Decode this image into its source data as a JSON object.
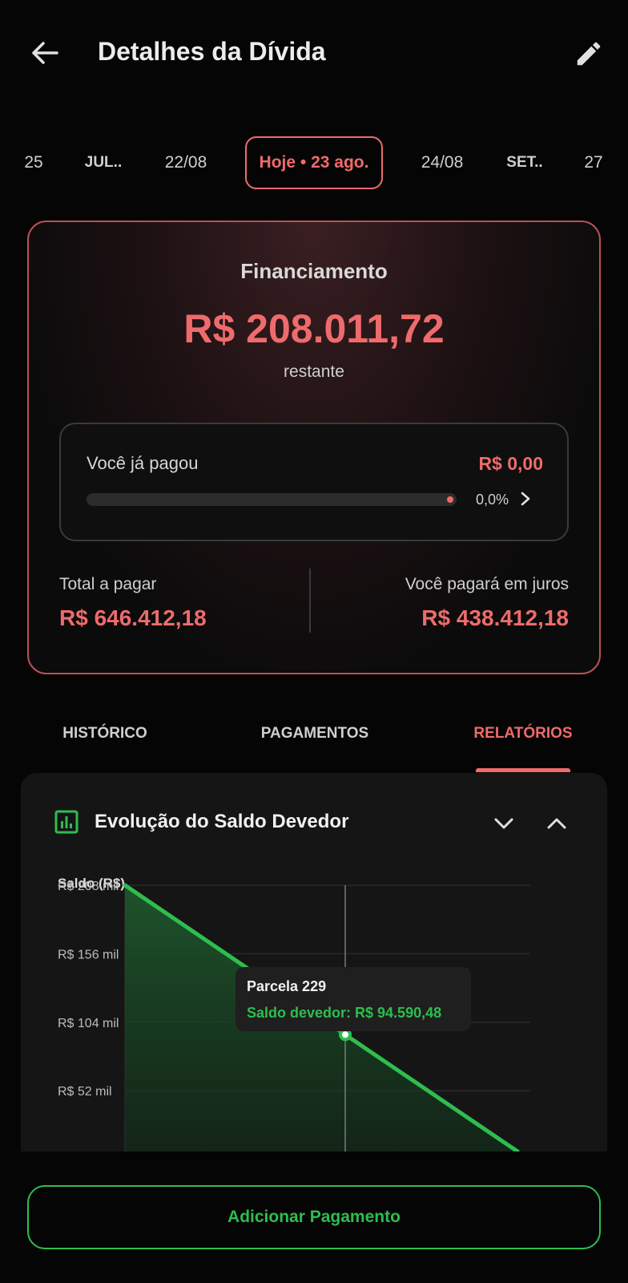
{
  "header": {
    "title": "Detalhes da Dívida",
    "back_icon": "arrow-left-icon",
    "edit_icon": "pencil-icon"
  },
  "dates": [
    {
      "label": "25",
      "style": "normal"
    },
    {
      "label": "JUL..",
      "style": "bold"
    },
    {
      "label": "22/08",
      "style": "normal"
    },
    {
      "label": "Hoje • 23 ago.",
      "style": "selected"
    },
    {
      "label": "24/08",
      "style": "normal"
    },
    {
      "label": "SET..",
      "style": "bold"
    },
    {
      "label": "27",
      "style": "normal"
    }
  ],
  "summary": {
    "title": "Financiamento",
    "amount": "R$ 208.011,72",
    "subtitle": "restante",
    "paid_label": "Você já pagou",
    "paid_value": "R$ 0,00",
    "paid_percent_text": "0,0%",
    "paid_progress": 0.0,
    "total_label": "Total a pagar",
    "total_value": "R$ 646.412,18",
    "interest_label": "Você pagará em juros",
    "interest_value": "R$ 438.412,18"
  },
  "tabs": [
    {
      "label": "HISTÓRICO",
      "active": false
    },
    {
      "label": "PAGAMENTOS",
      "active": false
    },
    {
      "label": "RELATÓRIOS",
      "active": true
    }
  ],
  "report": {
    "title": "Evolução do Saldo Devedor",
    "tooltip_title": "Parcela 229",
    "tooltip_value": "Saldo devedor: R$ 94.590,48"
  },
  "chart_data": {
    "type": "area",
    "ylabel": "Saldo (R$)",
    "ytick_labels": [
      "R$ 208 mil",
      "R$ 156 mil",
      "R$ 104 mil",
      "R$ 52 mil"
    ],
    "yticks": [
      208,
      156,
      104,
      52
    ],
    "ylim_visible": [
      0,
      208
    ],
    "points": [
      {
        "x": 0,
        "y": 208.01
      },
      {
        "x": 229,
        "y": 94.59
      }
    ],
    "highlight": {
      "x": 229,
      "y": 94.59
    },
    "line_color": "#2ebd4e"
  },
  "colors": {
    "accent_red": "#ef6b6b",
    "accent_green": "#2ebd4e",
    "background": "#050505"
  },
  "footer": {
    "add_payment_label": "Adicionar Pagamento"
  }
}
